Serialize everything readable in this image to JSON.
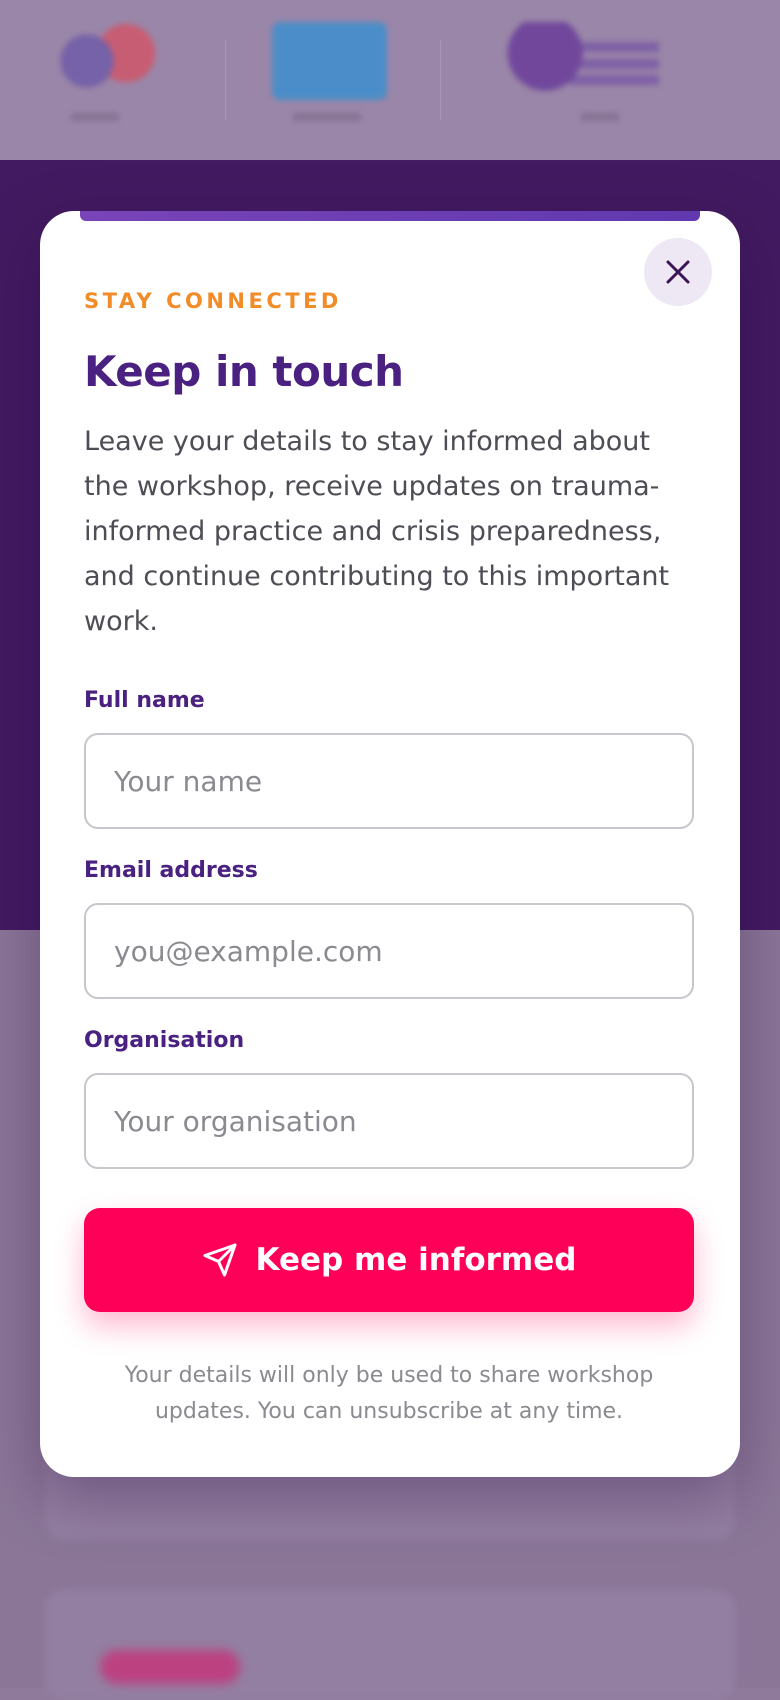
{
  "modal": {
    "eyebrow": "STAY CONNECTED",
    "title": "Keep in touch",
    "description": "Leave your details to stay informed about the workshop, receive updates on trauma-informed practice and crisis preparedness, and continue contributing to this important work.",
    "close_icon": "close-icon",
    "fields": {
      "name": {
        "label": "Full name",
        "placeholder": "Your name"
      },
      "email": {
        "label": "Email address",
        "placeholder": "you@example.com"
      },
      "organisation": {
        "label": "Organisation",
        "placeholder": "Your organisation"
      }
    },
    "submit_label": "Keep me informed",
    "submit_icon": "send-icon",
    "footnote": "Your details will only be used to share workshop updates. You can unsubscribe at any time."
  },
  "colors": {
    "accent": "#ff0059",
    "brand_purple": "#4a2181",
    "eyebrow_orange": "#f28c28",
    "overlay_band": "#421a61"
  }
}
